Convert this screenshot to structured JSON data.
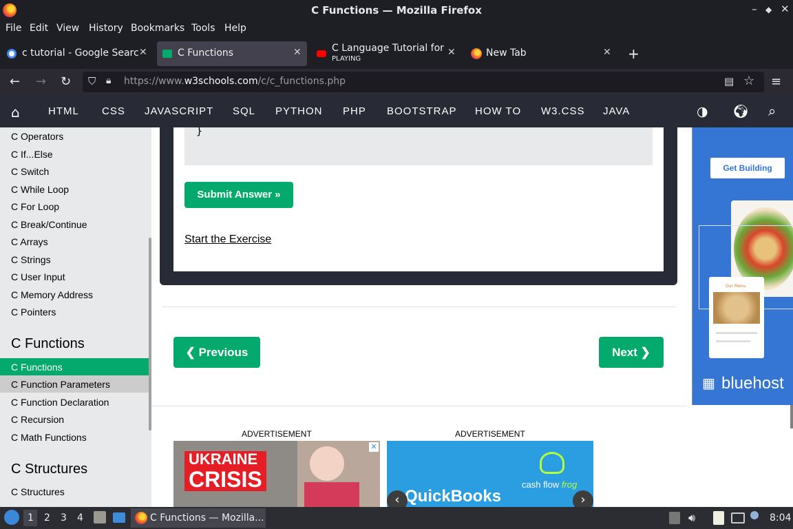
{
  "window": {
    "title": "C Functions — Mozilla Firefox"
  },
  "menu": [
    "File",
    "Edit",
    "View",
    "History",
    "Bookmarks",
    "Tools",
    "Help"
  ],
  "tabs": [
    {
      "label": "c tutorial - Google Search",
      "icon": "google-icon"
    },
    {
      "label": "C Functions",
      "icon": "w3schools-icon"
    },
    {
      "label": "C Language Tutorial for B",
      "sub": "PLAYING",
      "icon": "youtube-icon"
    },
    {
      "label": "New Tab",
      "icon": "firefox-icon"
    }
  ],
  "urlbar": {
    "prefix": "https://www.",
    "domain": "w3schools.com",
    "path": "/c/c_functions.php"
  },
  "w3nav": [
    "HTML",
    "CSS",
    "JAVASCRIPT",
    "SQL",
    "PYTHON",
    "PHP",
    "BOOTSTRAP",
    "HOW TO",
    "W3.CSS",
    "JAVA"
  ],
  "sidebar": {
    "links_top": [
      "C Operators",
      "C If...Else",
      "C Switch",
      "C While Loop",
      "C For Loop",
      "C Break/Continue",
      "C Arrays",
      "C Strings",
      "C User Input",
      "C Memory Address",
      "C Pointers"
    ],
    "heading_functions": "C Functions",
    "links_functions": [
      "C Functions",
      "C Function Parameters",
      "C Function Declaration",
      "C Recursion",
      "C Math Functions"
    ],
    "heading_structures": "C Structures",
    "links_structures": [
      "C Structures"
    ]
  },
  "main": {
    "code_brace": "}",
    "submit_label": "Submit Answer »",
    "start_exercise": "Start the Exercise",
    "previous_label": "❮ Previous",
    "next_label": "Next ❯",
    "ad_label": "ADVERTISEMENT"
  },
  "ads": {
    "ukraine_line1": "UKRAINE",
    "ukraine_line2": "CRISIS",
    "quickbooks": "QuickBooks",
    "cashflow": "cash flow",
    "frog": "frog",
    "get_building": "Get Building",
    "bluehost": "bluehost",
    "our_menu": "Our Menu"
  },
  "taskbar": {
    "workspaces": [
      "1",
      "2",
      "3",
      "4"
    ],
    "window_label": "C Functions — Mozilla...",
    "clock": "8:04"
  }
}
